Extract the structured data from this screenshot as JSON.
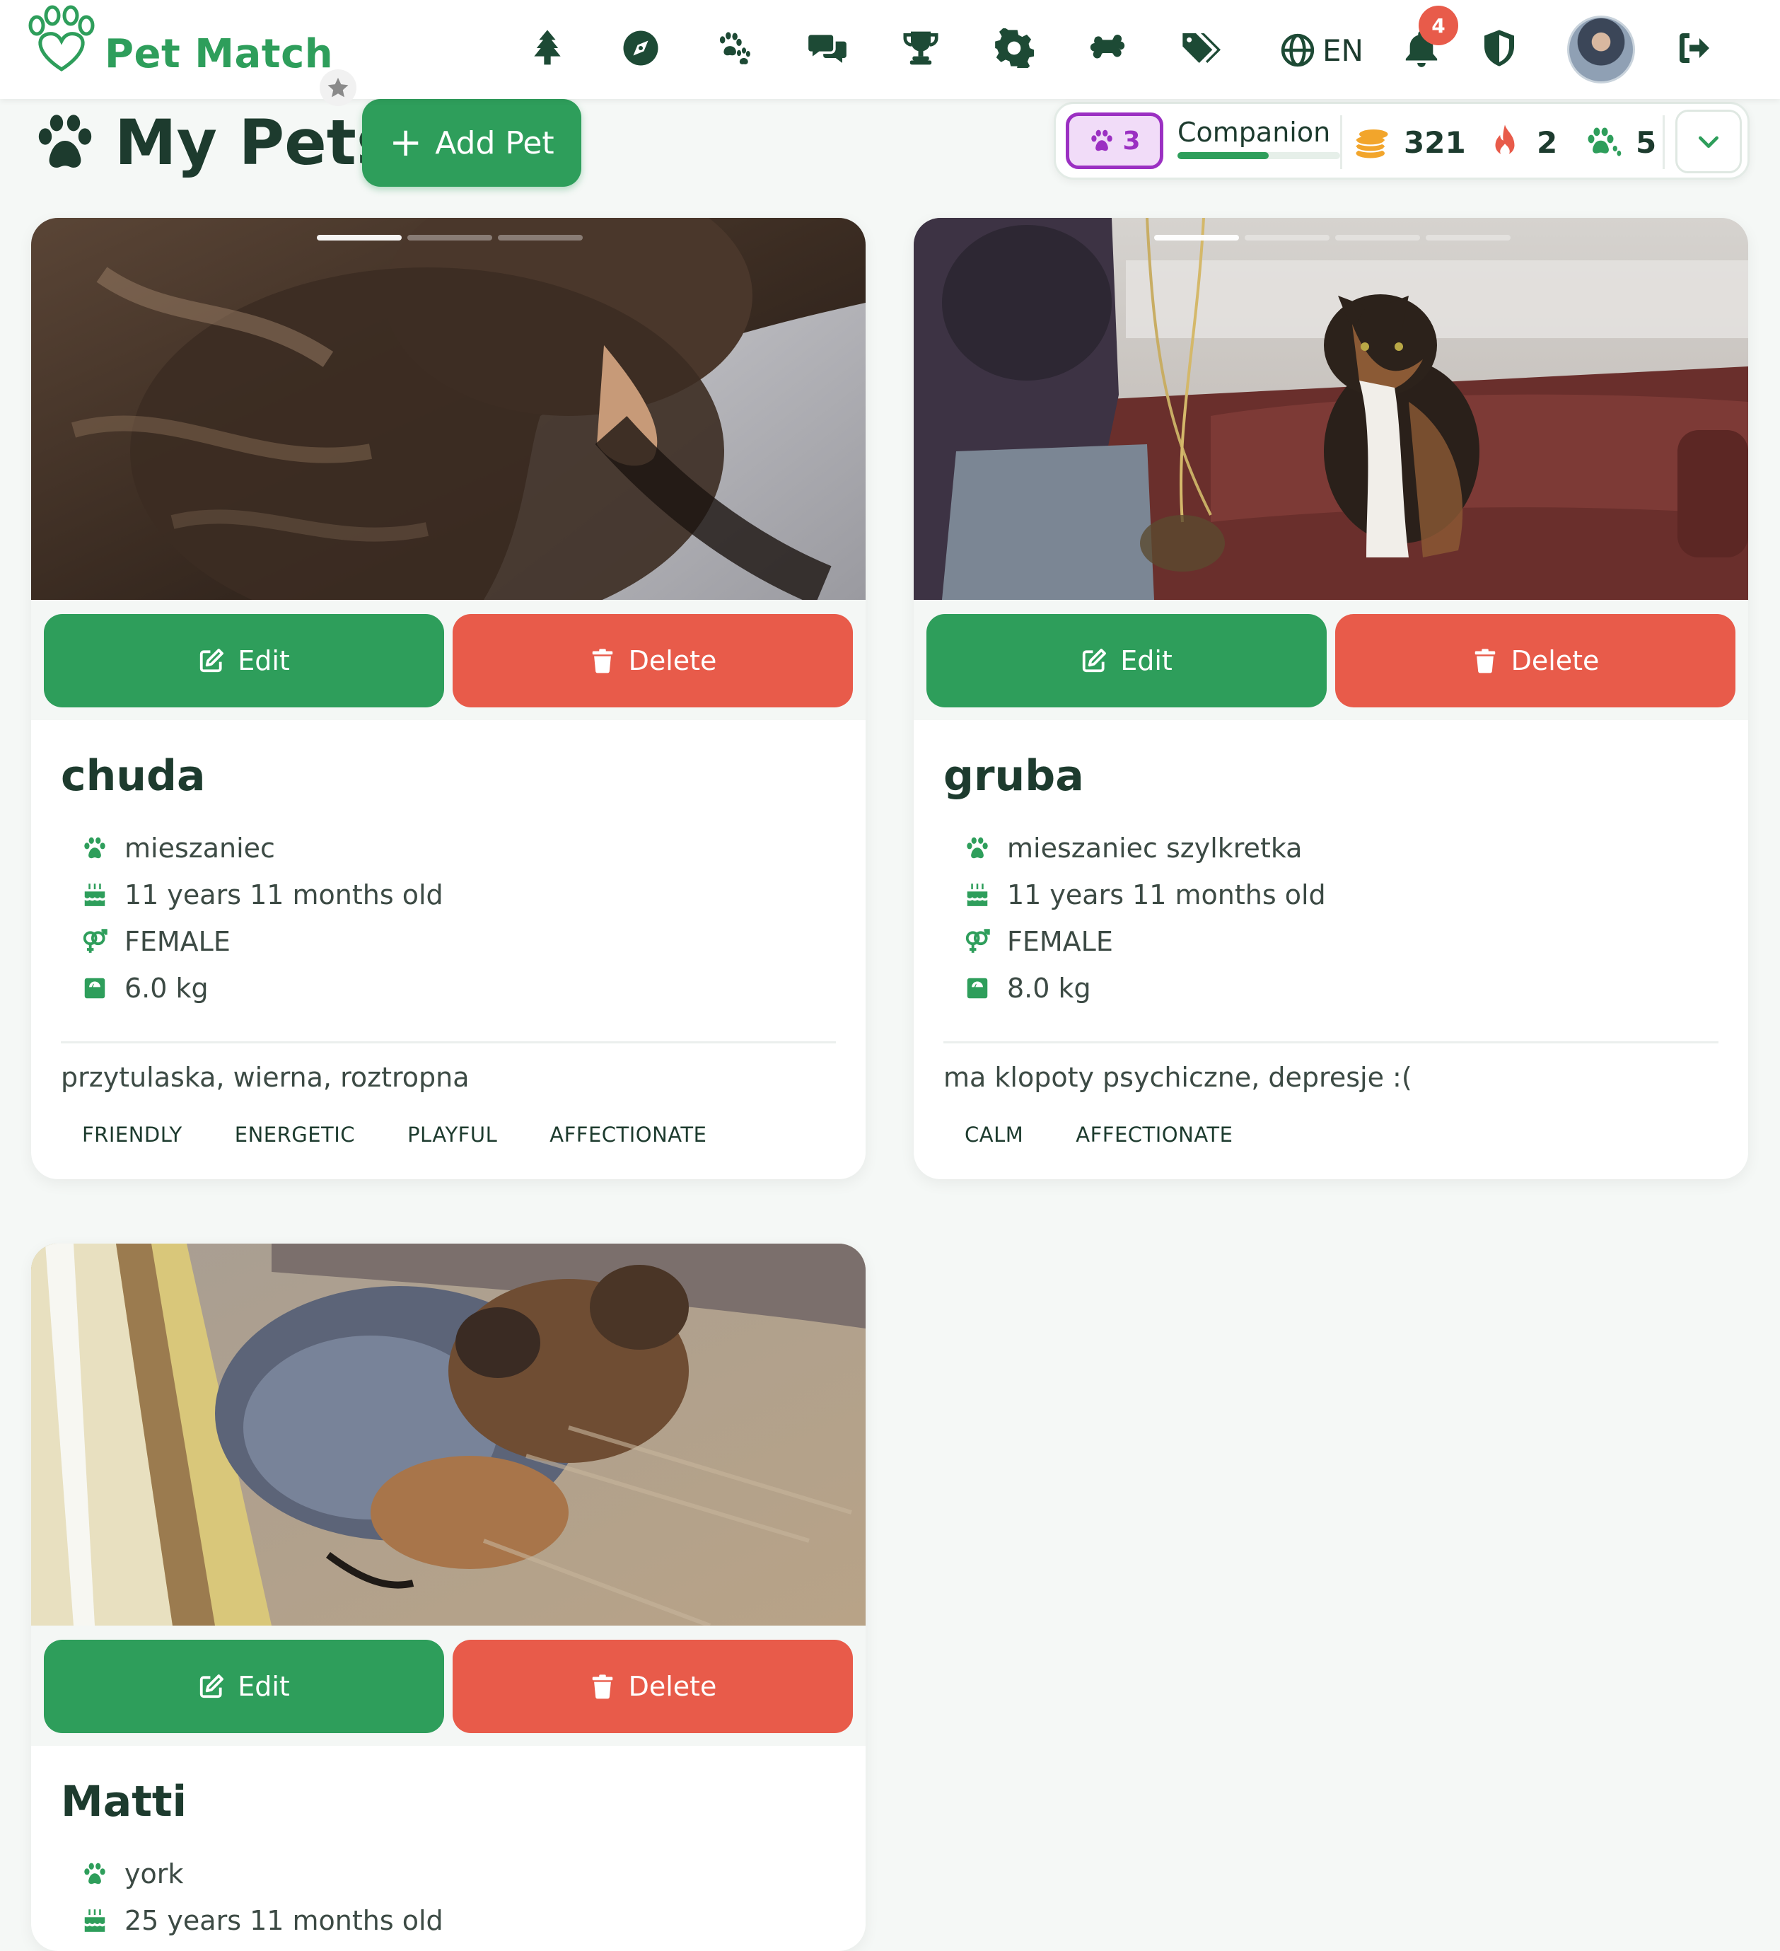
{
  "app": {
    "name": "Pet Match"
  },
  "header": {
    "nav": [
      {
        "name": "tree-icon"
      },
      {
        "name": "compass-icon"
      },
      {
        "name": "paws-icon"
      },
      {
        "name": "chat-icon"
      },
      {
        "name": "trophy-icon"
      },
      {
        "name": "gear-icon"
      },
      {
        "name": "bone-icon"
      },
      {
        "name": "tags-icon"
      }
    ],
    "language": "EN",
    "notifications_count": "4"
  },
  "page": {
    "title": "My Pets",
    "add_button": "Add Pet"
  },
  "stats": {
    "level": "3",
    "rank": "Companion",
    "rank_progress": 0.56,
    "coins": "321",
    "streak": "2",
    "paws": "5"
  },
  "labels": {
    "edit": "Edit",
    "delete": "Delete"
  },
  "pets": [
    {
      "name": "chuda",
      "breed": "mieszaniec",
      "age": "11 years 11 months old",
      "gender": "FEMALE",
      "weight": "6.0 kg",
      "description": "przytulaska, wierna, roztropna",
      "traits": [
        "FRIENDLY",
        "ENERGETIC",
        "PLAYFUL",
        "AFFECTIONATE"
      ],
      "photo_count": 3
    },
    {
      "name": "gruba",
      "breed": "mieszaniec szylkretka",
      "age": "11 years 11 months old",
      "gender": "FEMALE",
      "weight": "8.0 kg",
      "description": "ma klopoty psychiczne, depresje :(",
      "traits": [
        "CALM",
        "AFFECTIONATE"
      ],
      "photo_count": 4
    },
    {
      "name": "Matti",
      "breed": "york",
      "age": "25 years 11 months old"
    }
  ],
  "colors": {
    "primary": "#2e9e5b",
    "danger": "#e85b4a",
    "text": "#1d3b2e",
    "level": "#9b30c2"
  }
}
